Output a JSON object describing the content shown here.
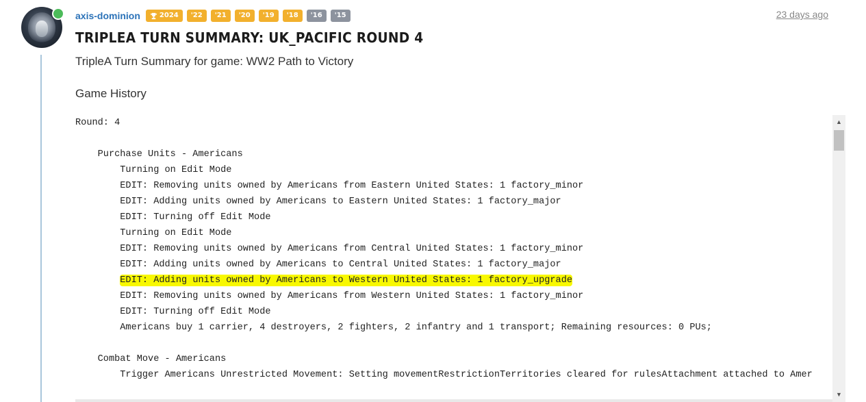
{
  "post": {
    "username": "axis-dominion",
    "badges": [
      {
        "label": "2024",
        "icon": "trophy-icon",
        "color": "#f2b02d"
      },
      {
        "label": "'22",
        "color": "#f2b02d"
      },
      {
        "label": "'21",
        "color": "#f2b02d"
      },
      {
        "label": "'20",
        "color": "#f2b02d"
      },
      {
        "label": "'19",
        "color": "#f2b02d"
      },
      {
        "label": "'18",
        "color": "#f2b02d"
      },
      {
        "label": "'16",
        "color": "#8d939e"
      },
      {
        "label": "'15",
        "color": "#8d939e"
      }
    ],
    "timestamp": "23 days ago",
    "title": "TRIPLEA TURN SUMMARY: UK_PACIFIC ROUND 4",
    "intro": "TripleA Turn Summary for game: WW2 Path to Victory",
    "section": "Game History"
  },
  "code": {
    "lines": [
      "Round: 4",
      "",
      "    Purchase Units - Americans",
      "        Turning on Edit Mode",
      "        EDIT: Removing units owned by Americans from Eastern United States: 1 factory_minor",
      "        EDIT: Adding units owned by Americans to Eastern United States: 1 factory_major",
      "        EDIT: Turning off Edit Mode",
      "        Turning on Edit Mode",
      "        EDIT: Removing units owned by Americans from Central United States: 1 factory_minor",
      "        EDIT: Adding units owned by Americans to Central United States: 1 factory_major",
      "        EDIT: Adding units owned by Americans to Western United States: 1 factory_upgrade",
      "        EDIT: Removing units owned by Americans from Western United States: 1 factory_minor",
      "        EDIT: Turning off Edit Mode",
      "        Americans buy 1 carrier, 4 destroyers, 2 fighters, 2 infantry and 1 transport; Remaining resources: 0 PUs;",
      "",
      "    Combat Move - Americans",
      "        Trigger Americans Unrestricted Movement: Setting movementRestrictionTerritories cleared for rulesAttachment attached to Amer"
    ],
    "highlighted_line": 10,
    "highlight_color": "#f8f800"
  },
  "colors": {
    "username": "#2b72b8",
    "online": "#4cbb5a",
    "thread_line": "#a9c6db"
  }
}
